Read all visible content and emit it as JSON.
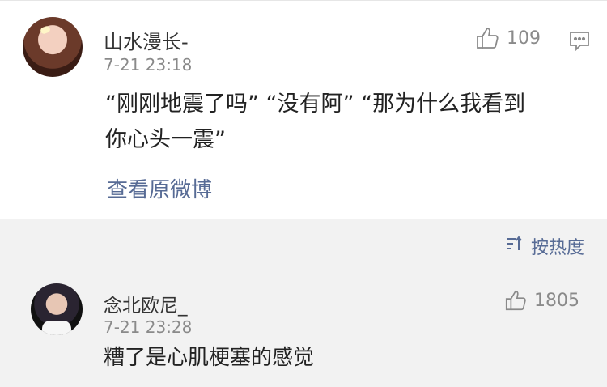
{
  "post": {
    "username": "山水漫长-",
    "timestamp": "7-21 23:18",
    "content": "“刚刚地震了吗” “没有阿” “那为什么我看到你心头一震”",
    "content_line1": "“刚刚地震了吗” “没有阿” “那为什么我看到",
    "content_line2": "你心头一震”",
    "like_count": "109",
    "view_original_label": "查看原微博"
  },
  "sort": {
    "label": "按热度",
    "icon": "sort-icon"
  },
  "comment": {
    "username": "念北欧尼_",
    "timestamp": "7-21 23:28",
    "content": "糟了是心肌梗塞的感觉",
    "like_count": "1805"
  },
  "colors": {
    "link": "#576b95",
    "muted": "#8a8a8a",
    "background": "#f2f2f2"
  }
}
